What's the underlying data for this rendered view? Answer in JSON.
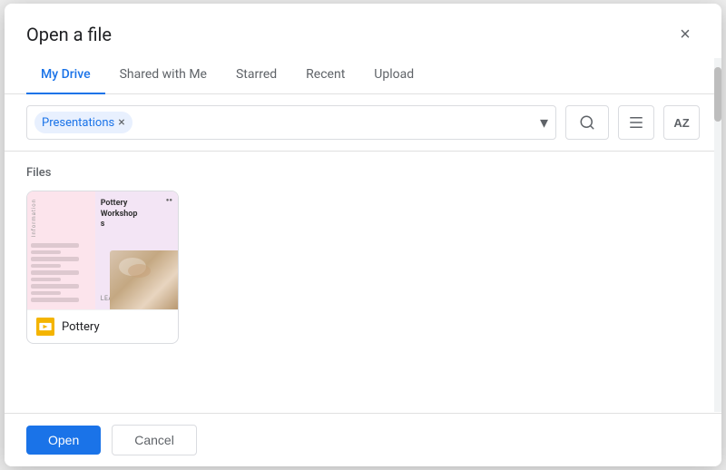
{
  "dialog": {
    "title": "Open a file",
    "close_label": "×"
  },
  "tabs": [
    {
      "id": "my-drive",
      "label": "My Drive",
      "active": true
    },
    {
      "id": "shared-with-me",
      "label": "Shared with Me",
      "active": false
    },
    {
      "id": "starred",
      "label": "Starred",
      "active": false
    },
    {
      "id": "recent",
      "label": "Recent",
      "active": false
    },
    {
      "id": "upload",
      "label": "Upload",
      "active": false
    }
  ],
  "toolbar": {
    "filter_chip_label": "Presentations",
    "filter_chip_close": "×",
    "dropdown_arrow": "▾",
    "search_icon": "🔍",
    "list_icon": "☰",
    "sort_icon": "AZ"
  },
  "content": {
    "section_label": "Files",
    "files": [
      {
        "id": "pottery",
        "name": "Pottery",
        "thumbnail_title": "Pottery Workshops",
        "learn_label": "LEARN TOGETHER"
      }
    ]
  },
  "footer": {
    "open_label": "Open",
    "cancel_label": "Cancel"
  }
}
